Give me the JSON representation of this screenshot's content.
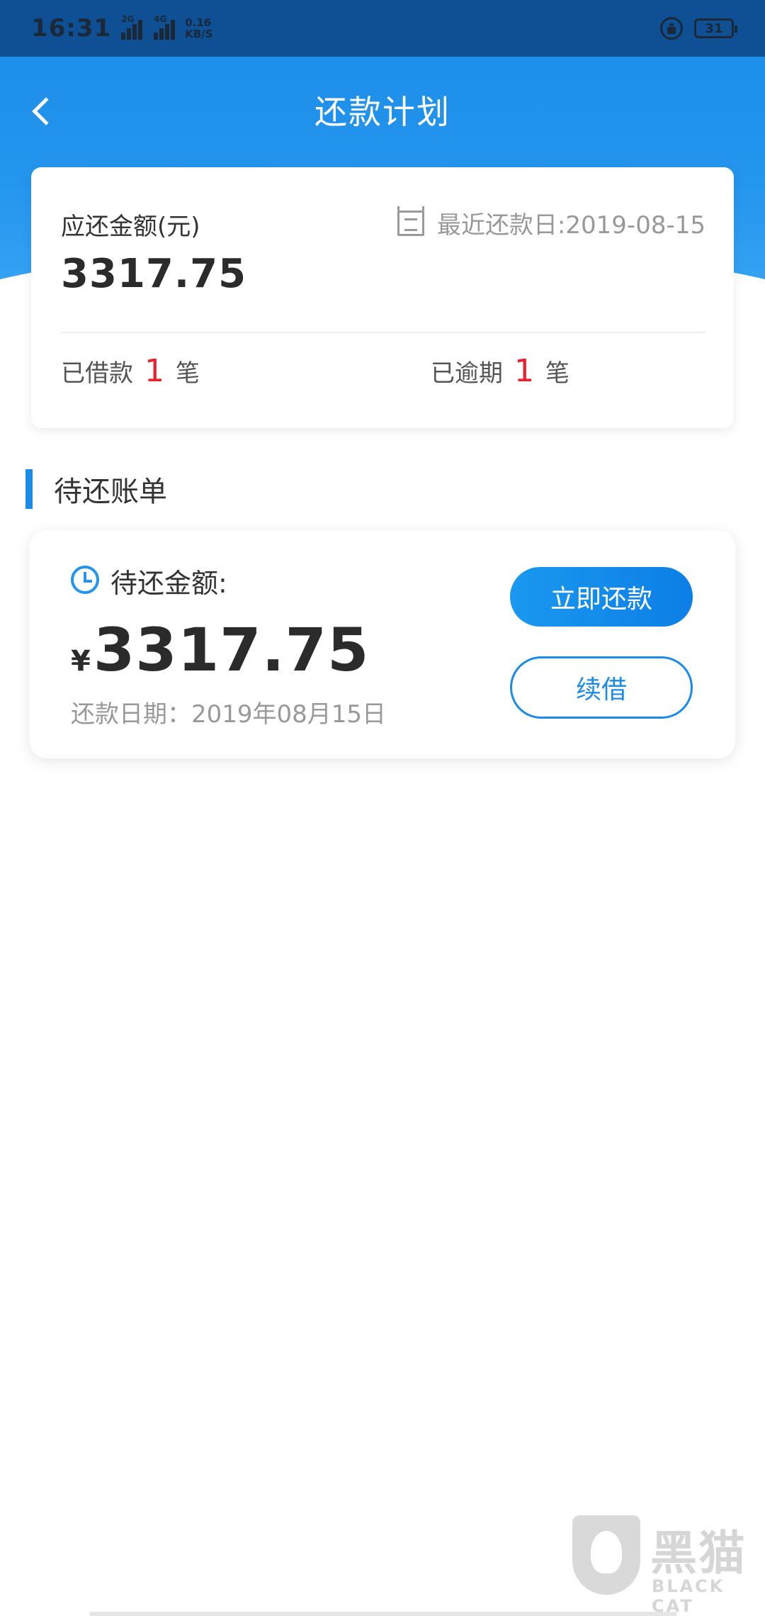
{
  "status_bar": {
    "time": "16:31",
    "signal1_label": "2G",
    "signal2_label": "4G",
    "speed_value": "0.16",
    "speed_unit": "KB/S",
    "battery": "31"
  },
  "header": {
    "title": "还款计划"
  },
  "summary": {
    "due_label": "应还金额(元)",
    "due_amount": "3317.75",
    "recent_date": "最近还款日:2019-08-15",
    "borrowed_label": "已借款",
    "borrowed_count": "1",
    "borrowed_unit": "笔",
    "overdue_label": "已逾期",
    "overdue_count": "1",
    "overdue_unit": "笔"
  },
  "section": {
    "title": "待还账单"
  },
  "bill": {
    "pending_label": "待还金额:",
    "currency": "¥",
    "amount": "3317.75",
    "repay_date": "还款日期：2019年08月15日",
    "repay_button": "立即还款",
    "renew_button": "续借"
  },
  "watermark": {
    "title": "黑猫",
    "subtitle": "BLACK CAT"
  },
  "colors": {
    "primary": "#1a8be8",
    "accent_red": "#e8212e"
  }
}
